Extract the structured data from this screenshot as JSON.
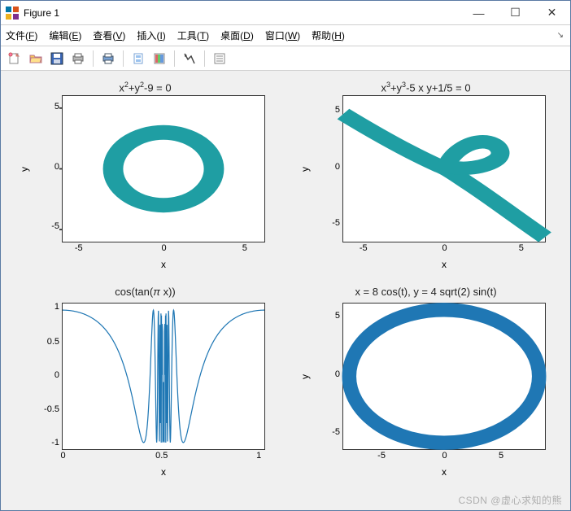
{
  "window": {
    "title": "Figure 1",
    "minimize": "—",
    "maximize": "☐",
    "close": "✕"
  },
  "menubar": [
    {
      "label": "文件",
      "hot": "F"
    },
    {
      "label": "编辑",
      "hot": "E"
    },
    {
      "label": "查看",
      "hot": "V"
    },
    {
      "label": "插入",
      "hot": "I"
    },
    {
      "label": "工具",
      "hot": "T"
    },
    {
      "label": "桌面",
      "hot": "D"
    },
    {
      "label": "窗口",
      "hot": "W"
    },
    {
      "label": "帮助",
      "hot": "H"
    }
  ],
  "toolbar_icons": [
    "new-figure-icon",
    "open-icon",
    "save-icon",
    "print-icon",
    "sep",
    "print-preview-icon",
    "sep",
    "link-icon",
    "colorbar-icon",
    "sep",
    "pointer-icon",
    "sep",
    "data-tips-icon"
  ],
  "chart_data": [
    {
      "type": "line",
      "title": "x^2 + y^2 - 9 = 0",
      "xlabel": "x",
      "ylabel": "y",
      "xlim": [
        -6,
        6
      ],
      "ylim": [
        -6,
        6
      ],
      "xticks": [
        -5,
        0,
        5
      ],
      "yticks": [
        -5,
        0,
        5
      ],
      "description": "Circle of radius 3 centered at origin",
      "equation": "x^2 + y^2 = 9",
      "color": "#1f9ea3"
    },
    {
      "type": "line",
      "title": "x^3 + y^3 - 5 x y + 1/5 = 0",
      "xlabel": "x",
      "ylabel": "y",
      "xlim": [
        -6.5,
        6.5
      ],
      "ylim": [
        -6.5,
        6.5
      ],
      "xticks": [
        -5,
        0,
        5
      ],
      "yticks": [
        -5,
        0,
        5
      ],
      "description": "Folium-like cubic with small loop near origin and asymptotic branch",
      "color": "#1f9ea3"
    },
    {
      "type": "line",
      "title": "cos(tan(π x))",
      "xlabel": "x",
      "ylabel": "",
      "xlim": [
        0,
        1
      ],
      "ylim": [
        -1.1,
        1.1
      ],
      "xticks": [
        0,
        0.5,
        1
      ],
      "yticks": [
        -1,
        -0.5,
        0,
        0.5,
        1
      ],
      "description": "y = cos(tan(pi*x)), rapid oscillation near x=0.5",
      "color": "#1f77b4"
    },
    {
      "type": "line",
      "title": "x = 8 cos(t), y = 4 sqrt(2) sin(t)",
      "xlabel": "x",
      "ylabel": "y",
      "xlim": [
        -8.5,
        8.5
      ],
      "ylim": [
        -6.2,
        6.2
      ],
      "xticks": [
        -5,
        0,
        5
      ],
      "yticks": [
        -5,
        0,
        5
      ],
      "description": "Parametric ellipse a=8 b=4*sqrt(2)≈5.657",
      "a": 8,
      "b": 5.6569,
      "color": "#1f77b4"
    }
  ],
  "watermark": "CSDN @虚心求知的熊"
}
